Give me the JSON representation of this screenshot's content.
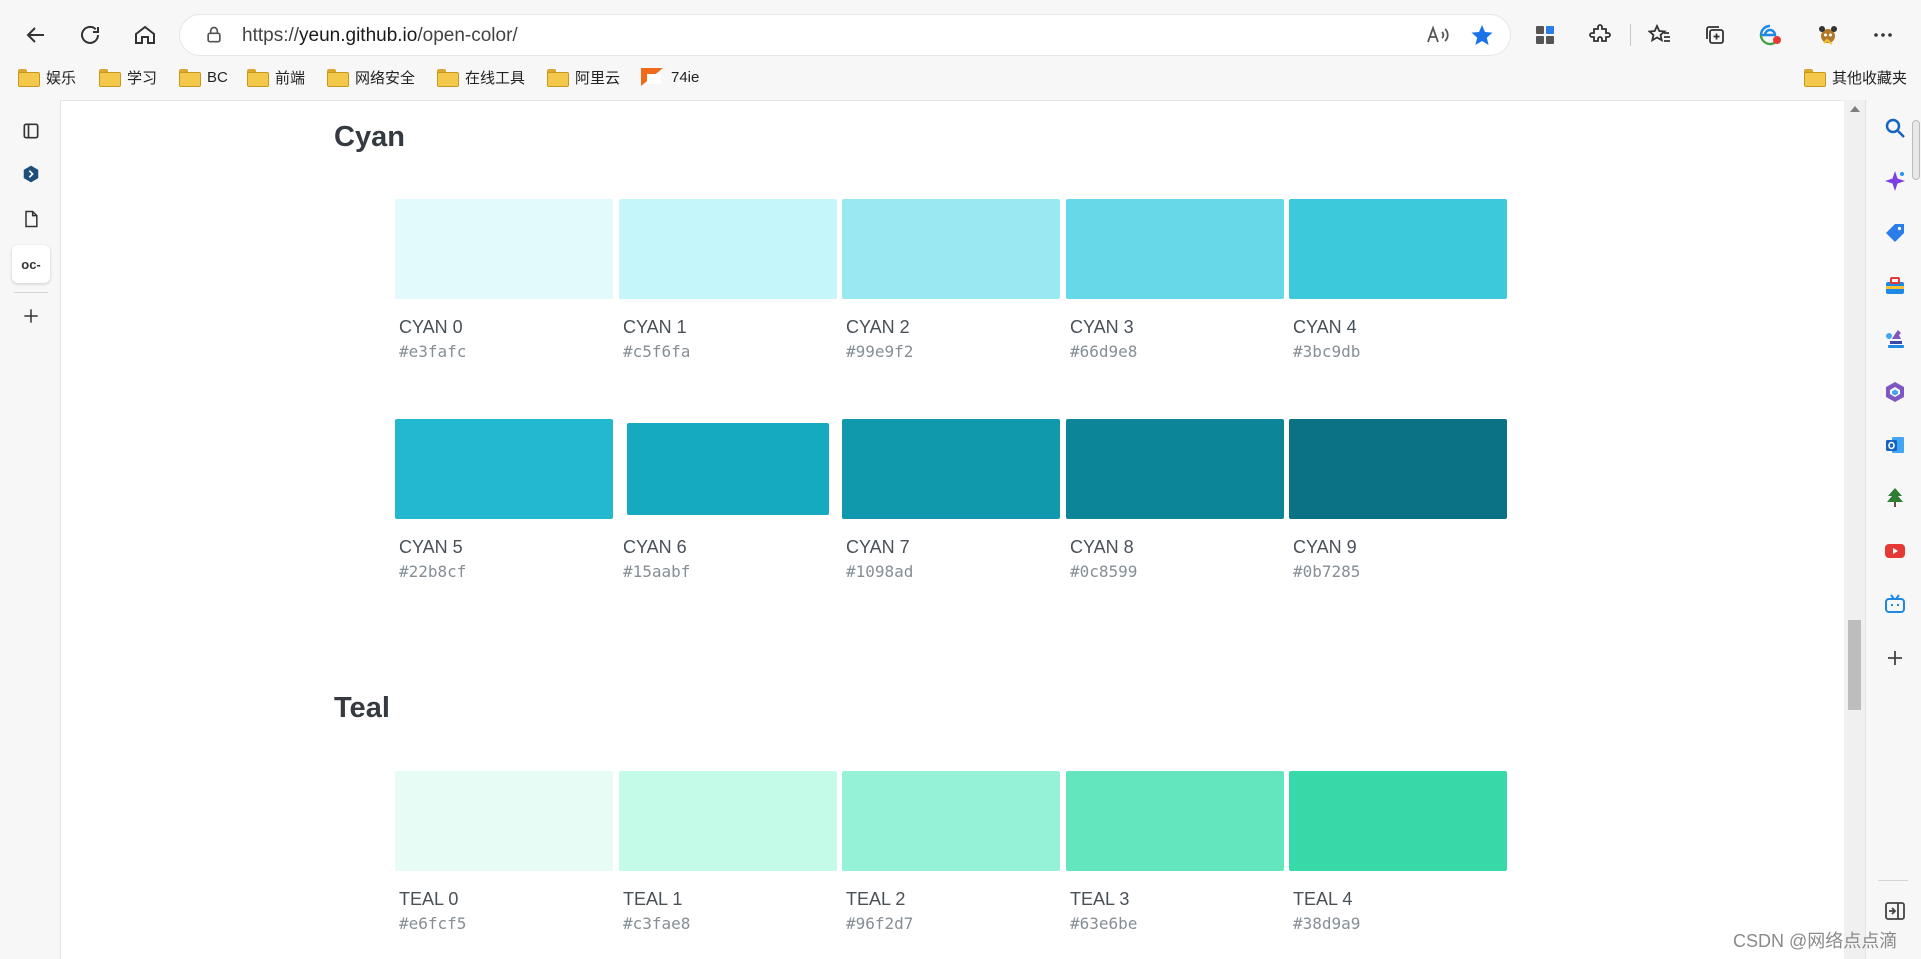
{
  "browser": {
    "url_prefix": "https://",
    "url_host": "yeun.github.io",
    "url_path": "/open-color/"
  },
  "bookmarks": [
    {
      "label": "娱乐",
      "icon": "folder-icon"
    },
    {
      "label": "学习",
      "icon": "folder-icon"
    },
    {
      "label": "BC",
      "icon": "folder-icon"
    },
    {
      "label": "前端",
      "icon": "folder-icon"
    },
    {
      "label": "网络安全",
      "icon": "folder-icon"
    },
    {
      "label": "在线工具",
      "icon": "folder-icon"
    },
    {
      "label": "阿里云",
      "icon": "folder-icon"
    },
    {
      "label": "74ie",
      "icon": "site-favicon-icon"
    }
  ],
  "bookmarks_other": "其他收藏夹",
  "left_rail": {
    "tab_label": "oc-"
  },
  "sections": [
    {
      "title": "Cyan",
      "swatches": [
        {
          "name": "CYAN 0",
          "hex": "#e3fafc"
        },
        {
          "name": "CYAN 1",
          "hex": "#c5f6fa"
        },
        {
          "name": "CYAN 2",
          "hex": "#99e9f2"
        },
        {
          "name": "CYAN 3",
          "hex": "#66d9e8"
        },
        {
          "name": "CYAN 4",
          "hex": "#3bc9db"
        },
        {
          "name": "CYAN 5",
          "hex": "#22b8cf"
        },
        {
          "name": "CYAN 6",
          "hex": "#15aabf"
        },
        {
          "name": "CYAN 7",
          "hex": "#1098ad"
        },
        {
          "name": "CYAN 8",
          "hex": "#0c8599"
        },
        {
          "name": "CYAN 9",
          "hex": "#0b7285"
        }
      ]
    },
    {
      "title": "Teal",
      "swatches": [
        {
          "name": "TEAL 0",
          "hex": "#e6fcf5"
        },
        {
          "name": "TEAL 1",
          "hex": "#c3fae8"
        },
        {
          "name": "TEAL 2",
          "hex": "#96f2d7"
        },
        {
          "name": "TEAL 3",
          "hex": "#63e6be"
        },
        {
          "name": "TEAL 4",
          "hex": "#38d9a9"
        }
      ]
    }
  ],
  "watermark": "CSDN @网络点点滴",
  "colors": {
    "favorite_star": "#1a73e8",
    "heading": "#343a40"
  }
}
